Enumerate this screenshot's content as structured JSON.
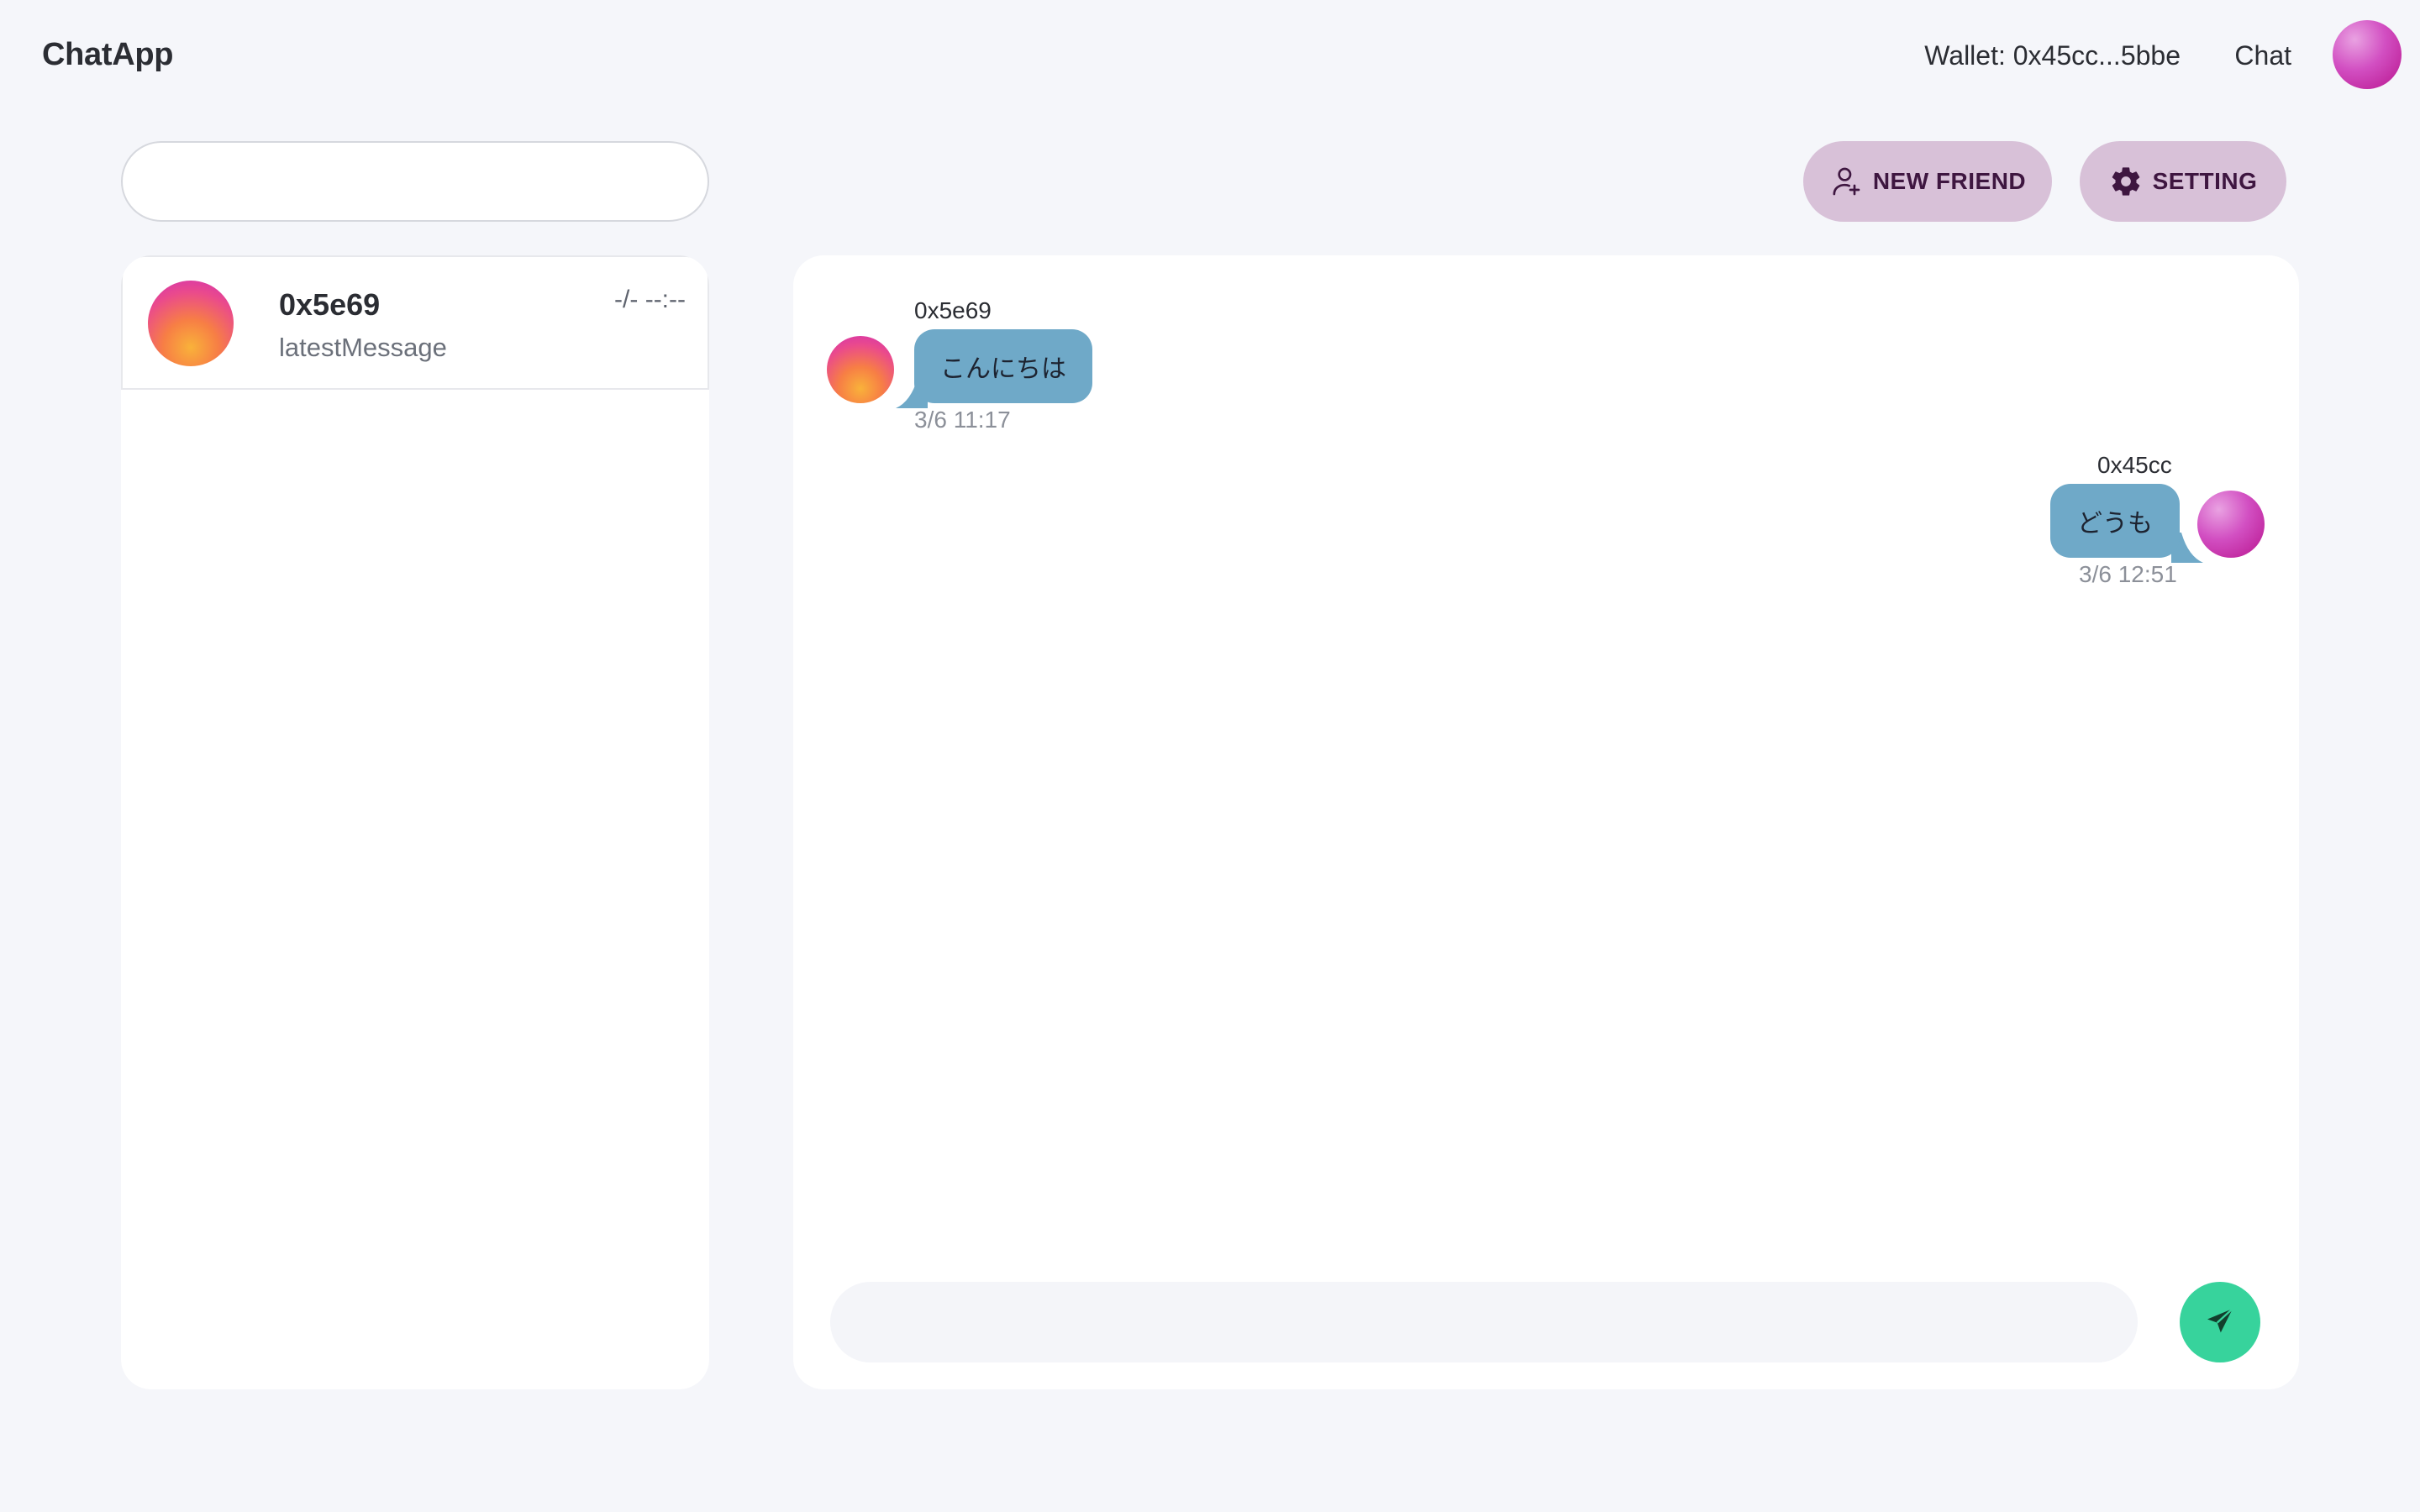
{
  "header": {
    "brand": "ChatApp",
    "wallet_label": "Wallet: 0x45cc...5bbe",
    "nav_chat": "Chat"
  },
  "search": {
    "placeholder": "",
    "value": ""
  },
  "actions": {
    "new_friend_label": "NEW FRIEND",
    "new_friend_icon": "user-plus-icon",
    "setting_label": "SETTING",
    "setting_icon": "gear-icon"
  },
  "friends": [
    {
      "name": "0x5e69",
      "time": "-/- --:--",
      "latest_message": "latestMessage"
    }
  ],
  "messages": [
    {
      "sender": "0x5e69",
      "text": "こんにちは",
      "time": "3/6 11:17",
      "side": "left"
    },
    {
      "sender": "0x45cc",
      "text": "どうも",
      "time": "3/6 12:51",
      "side": "right"
    }
  ],
  "composer": {
    "placeholder": "",
    "value": "",
    "send_icon": "send-icon"
  },
  "colors": {
    "background": "#f5f6fa",
    "pill_button": "#d8c1d8",
    "pill_text": "#3e1640",
    "bubble": "#6fa9c8",
    "send_button": "#37d39c"
  }
}
